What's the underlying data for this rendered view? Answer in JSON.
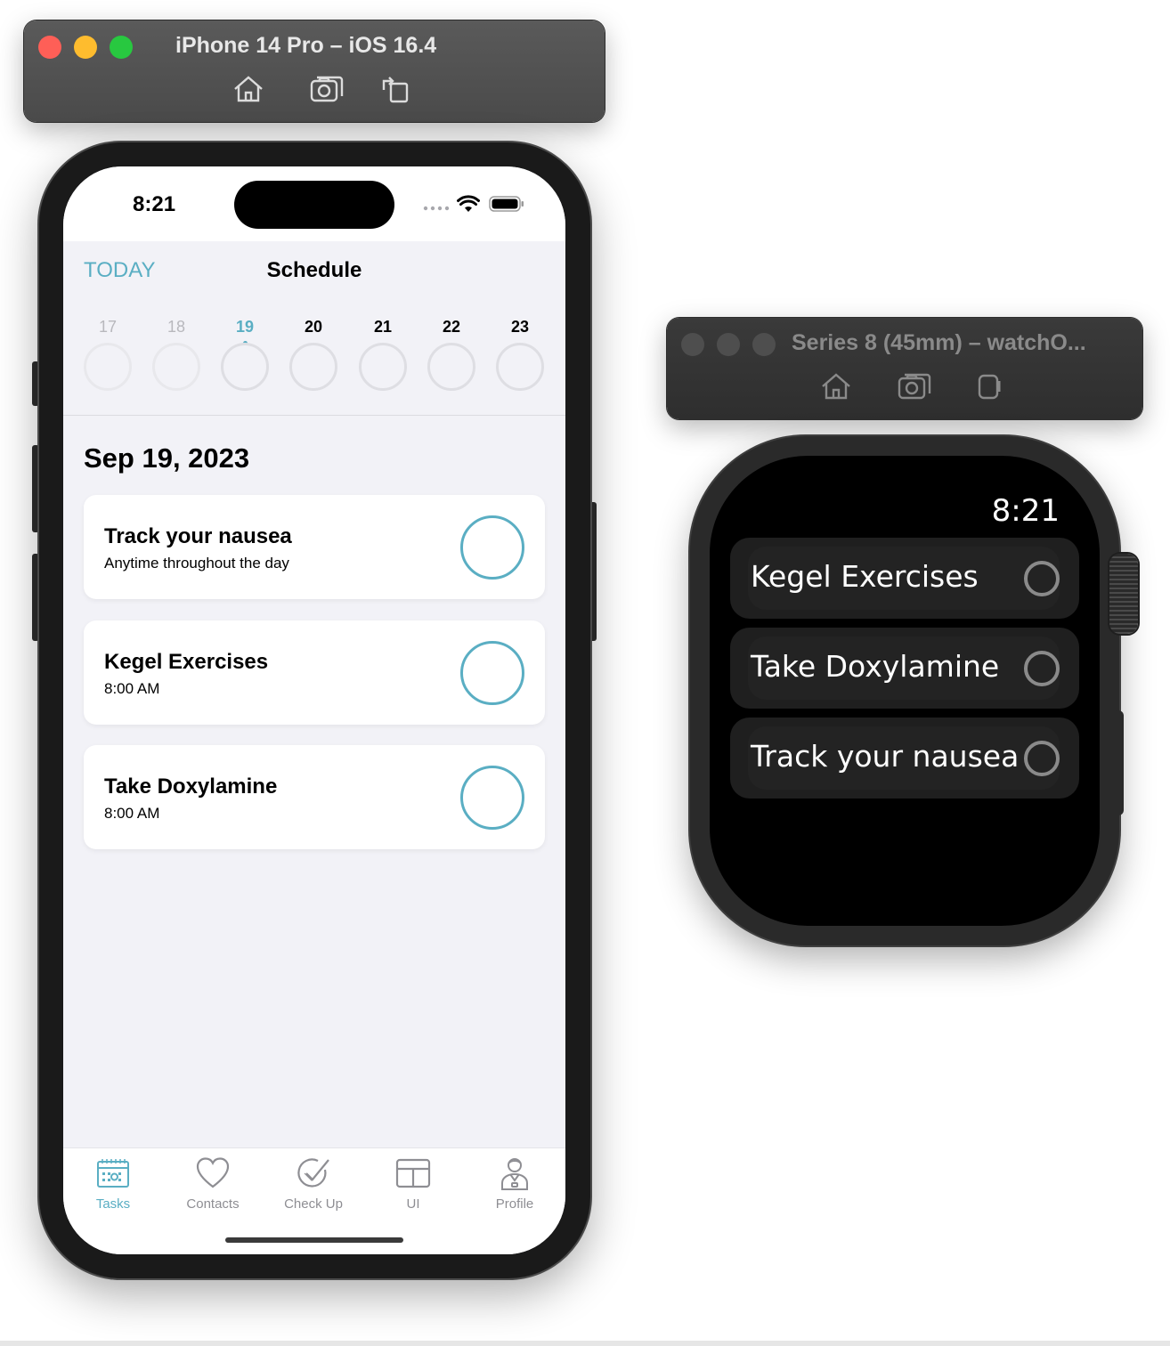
{
  "iphone_window": {
    "title": "iPhone 14 Pro – iOS 16.4",
    "tools": [
      "home-icon",
      "screenshot-icon",
      "rotate-icon"
    ]
  },
  "watch_window": {
    "title": "Series 8 (45mm) – watchO...",
    "tools": [
      "home-icon",
      "screenshot-icon",
      "side-button-icon"
    ]
  },
  "phone": {
    "status_time": "8:21",
    "nav": {
      "today": "TODAY",
      "title": "Schedule"
    },
    "week": [
      {
        "day": "17",
        "state": "past"
      },
      {
        "day": "18",
        "state": "past"
      },
      {
        "day": "19",
        "state": "selected"
      },
      {
        "day": "20",
        "state": "future"
      },
      {
        "day": "21",
        "state": "future"
      },
      {
        "day": "22",
        "state": "future"
      },
      {
        "day": "23",
        "state": "future"
      }
    ],
    "date_heading": "Sep 19, 2023",
    "tasks": [
      {
        "title": "Track your nausea",
        "subtitle": "Anytime throughout the day"
      },
      {
        "title": "Kegel Exercises",
        "subtitle": "8:00 AM"
      },
      {
        "title": "Take Doxylamine",
        "subtitle": "8:00 AM"
      }
    ],
    "tabs": [
      {
        "label": "Tasks",
        "icon": "calendar-icon",
        "active": true
      },
      {
        "label": "Contacts",
        "icon": "heart-icon",
        "active": false
      },
      {
        "label": "Check Up",
        "icon": "checkmark-seal-icon",
        "active": false
      },
      {
        "label": "UI",
        "icon": "layout-icon",
        "active": false
      },
      {
        "label": "Profile",
        "icon": "person-icon",
        "active": false
      }
    ]
  },
  "watch": {
    "time": "8:21",
    "tasks": [
      {
        "label": "Kegel Exercises"
      },
      {
        "label": "Take Doxylamine"
      },
      {
        "label": "Track your nausea"
      }
    ]
  },
  "colors": {
    "accent": "#5aaec3",
    "traffic_close": "#fe5f57",
    "traffic_minimize": "#febc2e",
    "traffic_zoom": "#28c840"
  }
}
